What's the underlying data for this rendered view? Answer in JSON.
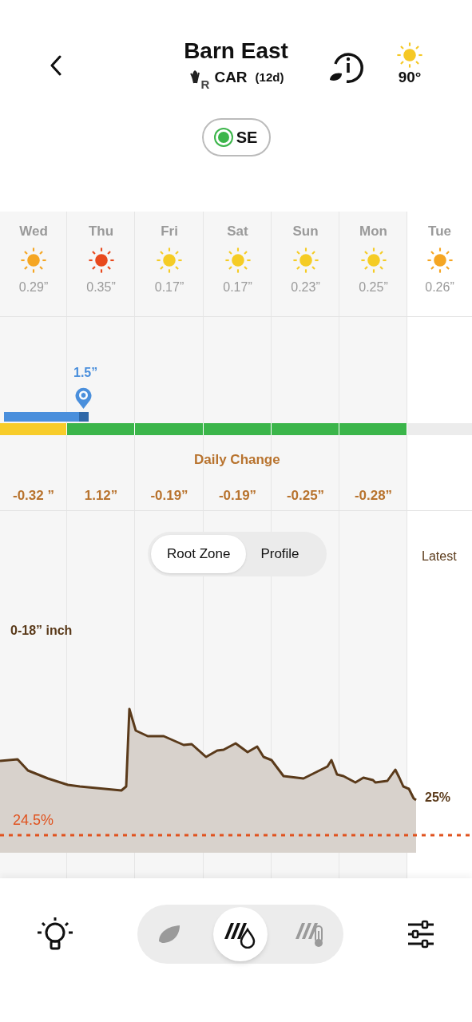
{
  "header": {
    "title": "Barn East",
    "stage_letter": "R",
    "crop": "CAR",
    "days": "(12d)",
    "temperature": "90°"
  },
  "sensor": {
    "label": "SE",
    "color": "#3bb54a"
  },
  "forecast": [
    {
      "day": "Wed",
      "precip": "0.29”",
      "color": "#f5a623"
    },
    {
      "day": "Thu",
      "precip": "0.35”",
      "color": "#e8491d"
    },
    {
      "day": "Fri",
      "precip": "0.17”",
      "color": "#f5cc25"
    },
    {
      "day": "Sat",
      "precip": "0.17”",
      "color": "#f5cc25"
    },
    {
      "day": "Sun",
      "precip": "0.23”",
      "color": "#f5cc25"
    },
    {
      "day": "Mon",
      "precip": "0.25”",
      "color": "#f5cc25"
    },
    {
      "day": "Tue",
      "precip": "0.26”",
      "color": "#f5a623"
    }
  ],
  "irrigation": {
    "amount": "1.5”"
  },
  "moisture_status": [
    {
      "color": "#f7cc2a"
    },
    {
      "color": "#3bb54a"
    },
    {
      "color": "#3bb54a"
    },
    {
      "color": "#3bb54a"
    },
    {
      "color": "#3bb54a"
    },
    {
      "color": "#3bb54a"
    }
  ],
  "daily_change": {
    "title": "Daily Change",
    "values": [
      "-0.32 ”",
      "1.12”",
      "-0.19”",
      "-0.19”",
      "-0.25”",
      "-0.28”"
    ]
  },
  "view_tabs": [
    {
      "label": "Root Zone",
      "selected": true
    },
    {
      "label": "Profile",
      "selected": false
    }
  ],
  "latest": "Latest",
  "chart": {
    "depth": "0-18” inch",
    "threshold": "24.5%",
    "current": "25%"
  },
  "bottom_nav": [
    {
      "kind": "crop",
      "selected": false
    },
    {
      "kind": "moisture",
      "selected": true
    },
    {
      "kind": "temperature",
      "selected": false
    }
  ]
}
